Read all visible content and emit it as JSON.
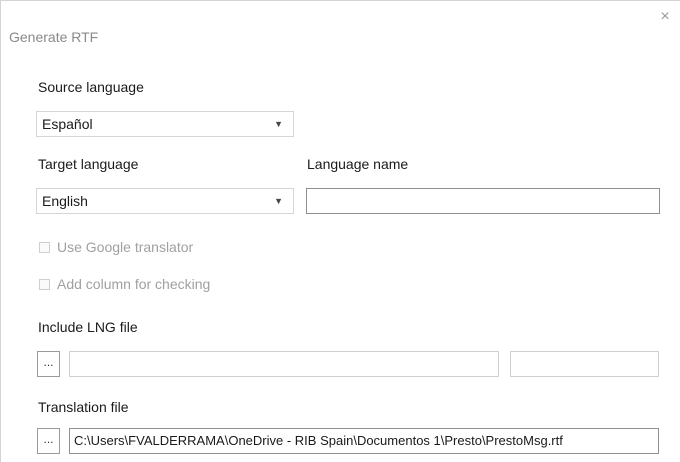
{
  "dialog": {
    "title": "Generate RTF",
    "close_glyph": "×"
  },
  "source_language": {
    "label": "Source language",
    "selected": "Español"
  },
  "target_language": {
    "label": "Target language",
    "selected": "English"
  },
  "language_name": {
    "label": "Language name",
    "value": ""
  },
  "options": {
    "use_google": {
      "label": "Use Google translator",
      "checked": false,
      "enabled": false
    },
    "add_column": {
      "label": "Add column for checking",
      "checked": false,
      "enabled": false
    }
  },
  "include_lng": {
    "label": "Include LNG file",
    "browse_label": "...",
    "path_value": "",
    "extra_value": ""
  },
  "translation_file": {
    "label": "Translation file",
    "browse_label": "...",
    "path_value": "C:\\Users\\FVALDERRAMA\\OneDrive - RIB Spain\\Documentos 1\\Presto\\PrestoMsg.rtf"
  },
  "icons": {
    "dropdown": "chevron-down-icon",
    "close": "close-icon"
  }
}
